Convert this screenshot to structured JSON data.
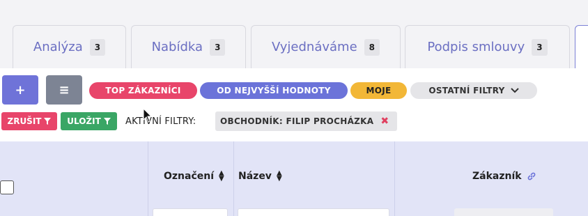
{
  "tabs": [
    {
      "label": "Analýza",
      "count": "3"
    },
    {
      "label": "Nabídka",
      "count": "3"
    },
    {
      "label": "Vyjednáváme",
      "count": "8"
    },
    {
      "label": "Podpis smlouvy",
      "count": "3"
    }
  ],
  "toolbar": {
    "add_label": "+",
    "menu_label": "≡",
    "filters": {
      "top": "TOP ZÁKAZNÍCI",
      "highest": "OD NEJVYŠŠÍ HODNOTY",
      "mine": "MOJE",
      "other": "OSTATNÍ FILTRY"
    },
    "cancel_label": "ZRUŠIT",
    "save_label": "ULOŽIT",
    "active_filters_label": "AKTIVNÍ FILTRY:",
    "active_filter_chip": "OBCHODNÍK: FILIP PROCHÁZKA"
  },
  "table": {
    "headers": {
      "oznaceni": "Označení",
      "nazev": "Název",
      "zakaznik": "Zákazník"
    }
  },
  "colors": {
    "accent": "#6b73d9",
    "danger": "#e8456a",
    "success": "#3aa665",
    "warning": "#f2b737"
  }
}
